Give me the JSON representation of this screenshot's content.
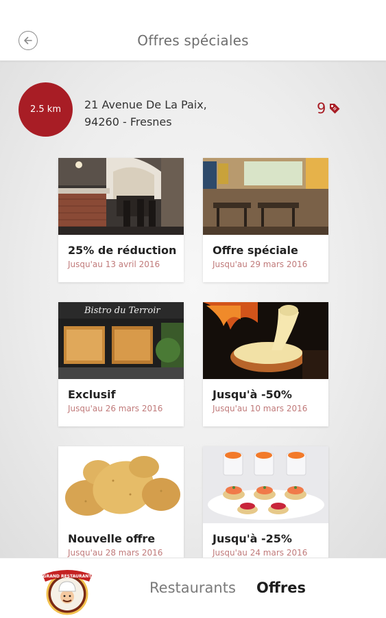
{
  "header": {
    "title": "Offres spéciales",
    "back_icon": "arrow-left-circle-icon"
  },
  "restaurant": {
    "distance": "2.5 km",
    "address_line1": "21 Avenue De La Paix,",
    "address_line2": "94260 - Fresnes",
    "offer_count": "9",
    "offer_icon": "tag-icon",
    "accent_color": "#a81d25"
  },
  "offers": [
    {
      "title": "25% de réduction",
      "date": "Jusqu'au 13 avril 2016",
      "image": "restaurant-interior-brick"
    },
    {
      "title": "Offre spéciale",
      "date": "Jusqu'au 29 mars 2016",
      "image": "restaurant-dining-room"
    },
    {
      "title": "Exclusif",
      "date": "Jusqu'au 26 mars 2016",
      "image": "bistro-du-terroir-storefront"
    },
    {
      "title": "Jusqu'à -50%",
      "date": "Jusqu'au 10 mars 2016",
      "image": "melted-cheese-raclette"
    },
    {
      "title": "Nouvelle offre",
      "date": "Jusqu'au 28 mars 2016",
      "image": "potatoes"
    },
    {
      "title": "Jusqu'à -25%",
      "date": "Jusqu'au 24 mars 2016",
      "image": "salmon-canapes"
    }
  ],
  "storefront_sign": "Bistro du Terroir",
  "bottom_nav": {
    "restaurants_label": "Restaurants",
    "offers_label": "Offres",
    "active": "Offres",
    "logo_text": "GRAND RESTAURANT"
  }
}
